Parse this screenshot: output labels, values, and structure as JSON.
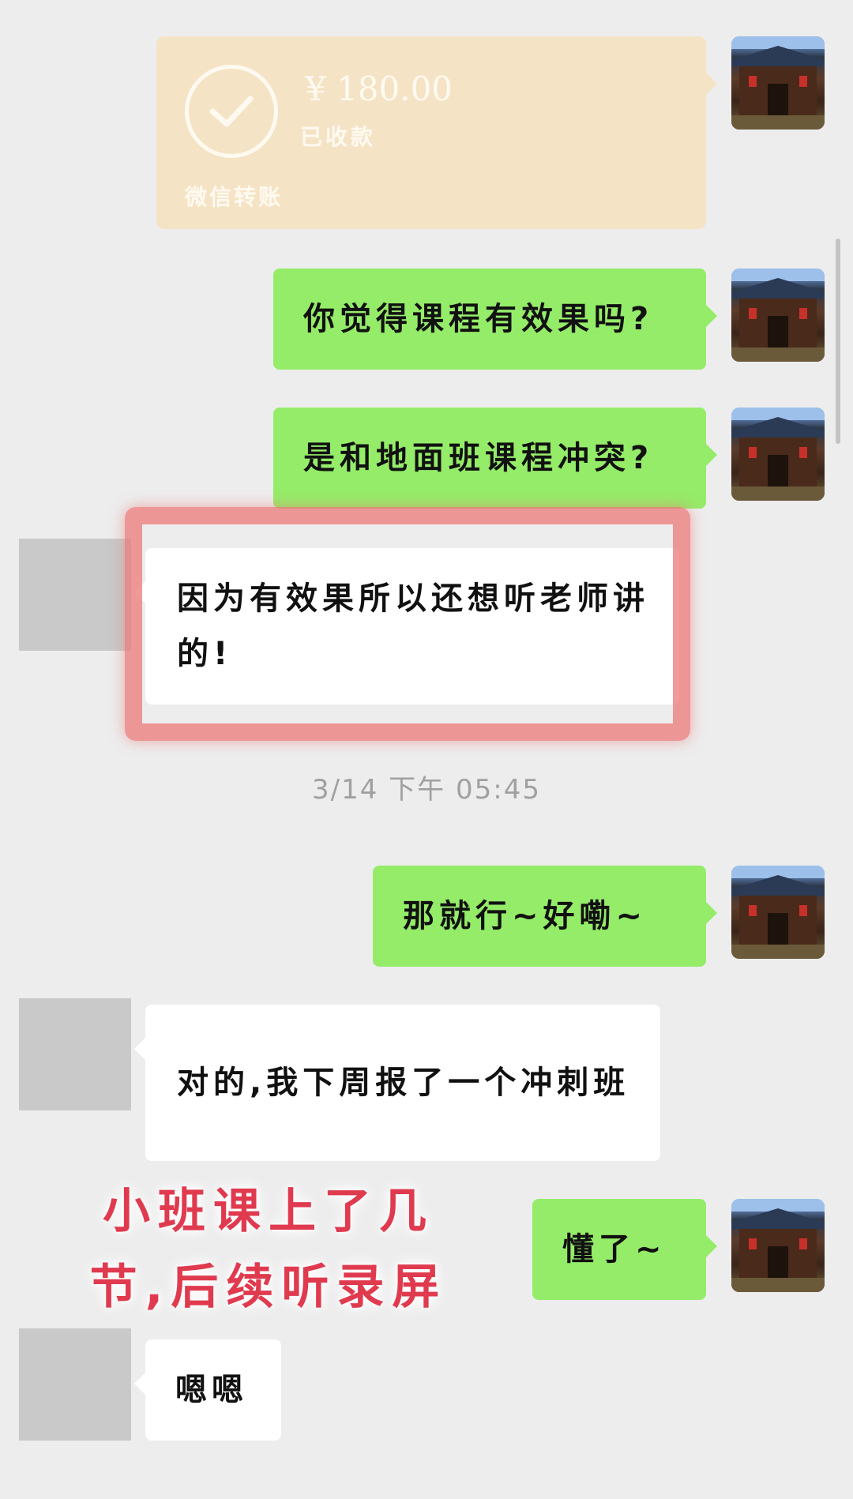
{
  "transfer": {
    "amount": "¥ 180.00",
    "status": "已收款",
    "label": "微信转账",
    "icon": "check-circle-icon"
  },
  "messages": [
    {
      "side": "self",
      "text": "你觉得课程有效果吗?"
    },
    {
      "side": "self",
      "text": "是和地面班课程冲突?"
    },
    {
      "side": "other",
      "text": "因为有效果所以还想听老师讲的!"
    },
    {
      "side": "self",
      "text": "那就行~好嘞~"
    },
    {
      "side": "other",
      "text": "对的,我下周报了一个冲刺班"
    },
    {
      "side": "self",
      "text": "懂了~"
    },
    {
      "side": "other",
      "text": "嗯嗯"
    }
  ],
  "timestamp": "3/14 下午 05:45",
  "annotation": {
    "line1": "小班课上了几",
    "line2": "节,后续听录屏"
  },
  "colors": {
    "background": "#ededed",
    "self_bubble": "#95ec69",
    "other_bubble": "#ffffff",
    "transfer_card": "#f5e3c5",
    "highlight": "#ec7878",
    "annotation_text": "#e03a4f"
  }
}
